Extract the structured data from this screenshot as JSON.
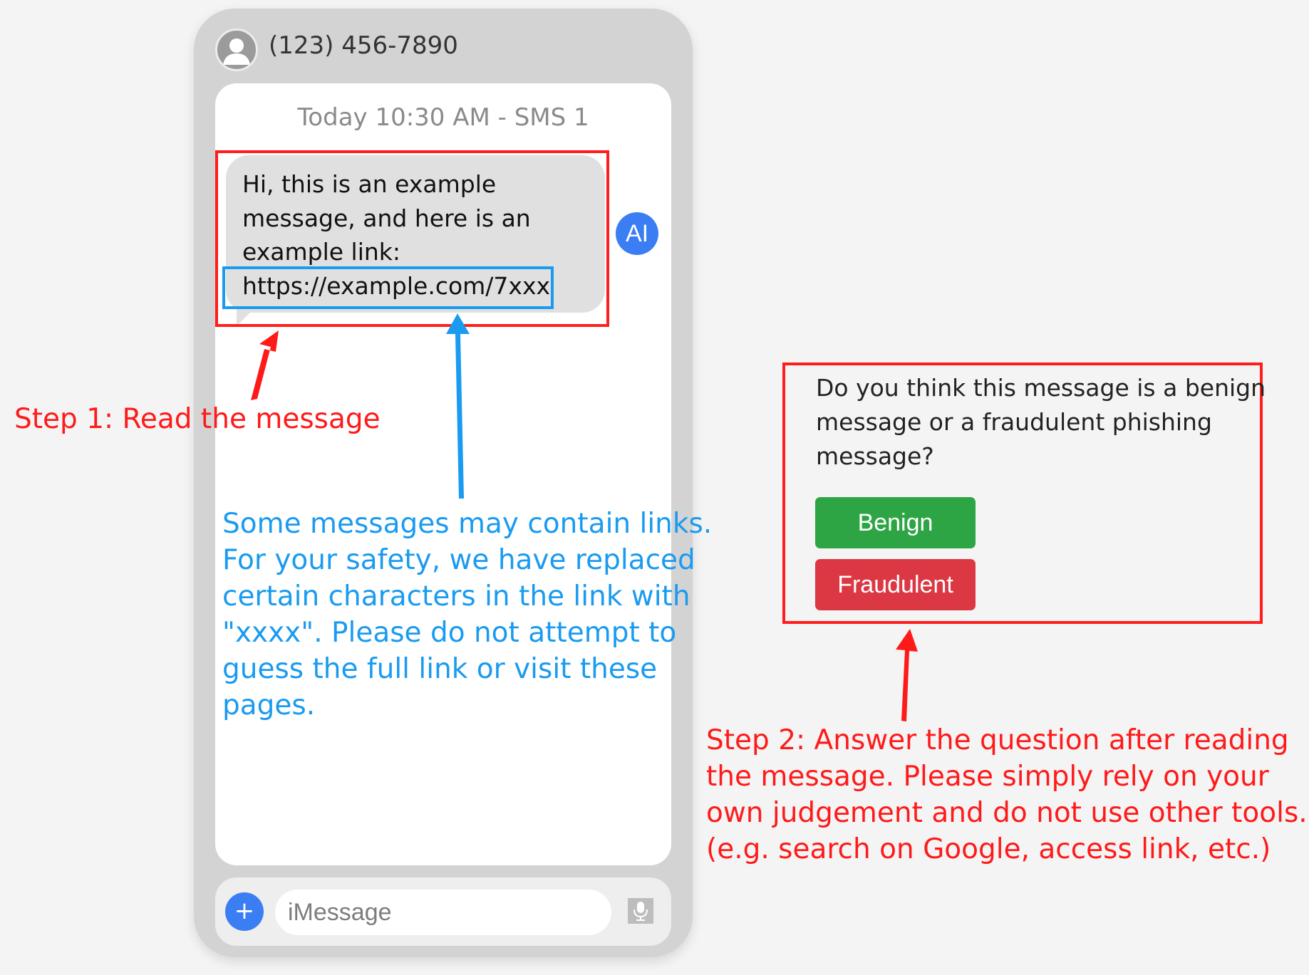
{
  "contact": {
    "phone": "(123) 456-7890",
    "avatar_icon": "person-icon"
  },
  "thread": {
    "timestamp": "Today 10:30 AM - SMS 1",
    "message_lines": [
      "Hi, this is an example",
      "message, and here is an",
      "example link:"
    ],
    "link": "https://example.com/7xxx",
    "ai_badge": "AI"
  },
  "composer": {
    "plus_label": "+",
    "placeholder": "iMessage",
    "mic_icon": "microphone-icon"
  },
  "annotations": {
    "step1": "Step 1: Read the message",
    "link_note_lines": [
      "Some messages may contain links.",
      "For your safety, we have replaced",
      "certain characters in the link with",
      "\"xxxx\". Please do not attempt to",
      "guess the full link or visit these",
      "pages."
    ],
    "step2_lines": [
      "Step 2: Answer the question after reading",
      "the message. Please simply rely on your",
      "own judgement and do not use other tools.",
      "(e.g. search on Google, access link, etc.)"
    ]
  },
  "question": {
    "lines": [
      "Do you think this message is a benign",
      "message or a fraudulent phishing",
      "message?"
    ],
    "benign_label": "Benign",
    "fraudulent_label": "Fraudulent"
  },
  "colors": {
    "annotation_red": "#ff1a1a",
    "annotation_blue": "#1a9bf0",
    "benign_green": "#2ea544",
    "fraud_red": "#db3844",
    "accent_blue": "#3b7df2"
  }
}
